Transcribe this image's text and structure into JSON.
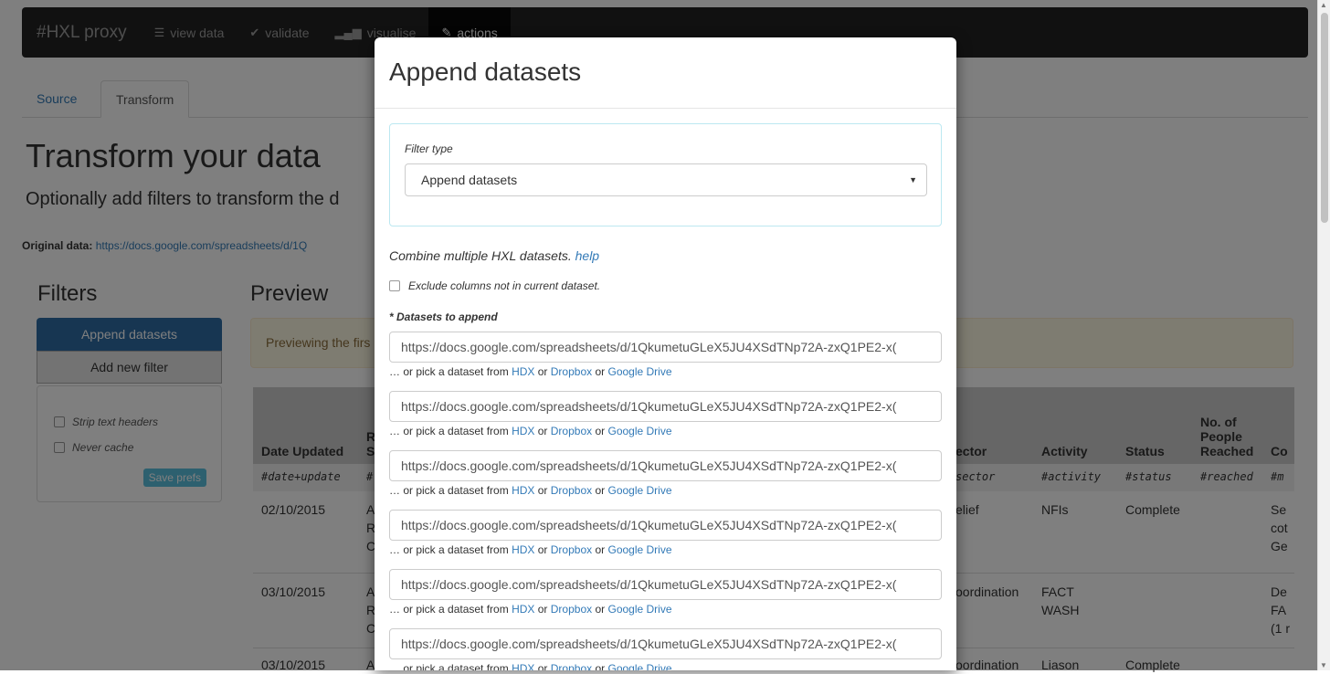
{
  "navbar": {
    "brand": "#HXL proxy",
    "items": [
      {
        "label": "view data",
        "icon": "list-icon"
      },
      {
        "label": "validate",
        "icon": "check-icon"
      },
      {
        "label": "visualise",
        "icon": "signal-icon"
      },
      {
        "label": "actions",
        "icon": "edit-icon"
      }
    ]
  },
  "tabs": [
    "Source",
    "Transform"
  ],
  "page": {
    "title": "Transform your data",
    "lead": "Optionally add filters to transform the d",
    "original_label": "Original data:",
    "original_url": "https://docs.google.com/spreadsheets/d/1Q"
  },
  "filters": {
    "heading": "Filters",
    "append_button": "Append datasets",
    "add_button": "Add new filter",
    "strip_headers": "Strip text headers",
    "never_cache": "Never cache",
    "save_prefs": "Save prefs"
  },
  "preview": {
    "heading": "Preview",
    "alert": "Previewing the firs"
  },
  "table": {
    "headers": [
      "Date Updated",
      "R\nS",
      "ector",
      "Activity",
      "Status",
      "No. of\nPeople\nReached",
      "Co"
    ],
    "tags": [
      "#date+update",
      "#",
      "sector",
      "#activity",
      "#status",
      "#reached",
      "#m"
    ],
    "rows": [
      {
        "date": "02/10/2015",
        "r": "A\nR\nC",
        "sector": "elief",
        "activity": "NFIs",
        "status": "Complete",
        "reached": "",
        "co": "Se\ncot\nGe"
      },
      {
        "date": "03/10/2015",
        "r": "A\nR\nC",
        "sector": "oordination",
        "activity": "FACT\nWASH",
        "status": "",
        "reached": "",
        "co": "De\nFA\n(1 r"
      },
      {
        "date": "03/10/2015",
        "r": "A",
        "sector": "oordination",
        "activity": "Liason",
        "status": "Complete",
        "reached": "",
        "co": ""
      }
    ]
  },
  "modal": {
    "title": "Append datasets",
    "filter_type_label": "Filter type",
    "filter_type_value": "Append datasets",
    "description": "Combine multiple HXL datasets.",
    "help_link": "help",
    "exclude_label": "Exclude columns not in current dataset.",
    "datasets_label": "* Datasets to append",
    "datasets": [
      "https://docs.google.com/spreadsheets/d/1QkumetuGLeX5JU4XSdTNp72A-zxQ1PE2-x(",
      "https://docs.google.com/spreadsheets/d/1QkumetuGLeX5JU4XSdTNp72A-zxQ1PE2-x(",
      "https://docs.google.com/spreadsheets/d/1QkumetuGLeX5JU4XSdTNp72A-zxQ1PE2-x(",
      "https://docs.google.com/spreadsheets/d/1QkumetuGLeX5JU4XSdTNp72A-zxQ1PE2-x(",
      "https://docs.google.com/spreadsheets/d/1QkumetuGLeX5JU4XSdTNp72A-zxQ1PE2-x(",
      "https://docs.google.com/spreadsheets/d/1QkumetuGLeX5JU4XSdTNp72A-zxQ1PE2-x("
    ],
    "pick_prefix": "… or pick a dataset from",
    "pick_hdx": "HDX",
    "pick_or": "or",
    "pick_dropbox": "Dropbox",
    "pick_gdrive": "Google Drive"
  }
}
